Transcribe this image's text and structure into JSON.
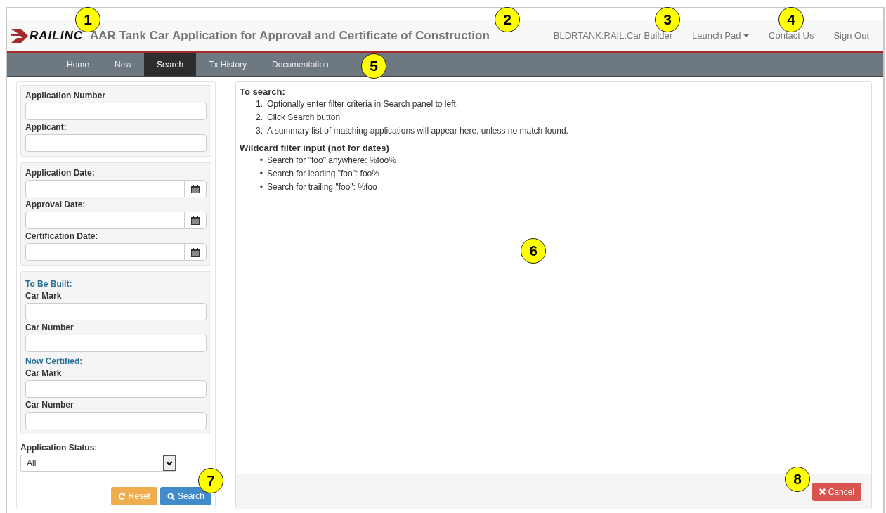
{
  "header": {
    "logo_text": "RAILINC",
    "title": "AAR Tank Car Application for Approval and Certificate of Construction",
    "menu": [
      {
        "label": "BLDRTANK:RAIL:Car Builder",
        "kind": "text"
      },
      {
        "label": "Launch Pad",
        "kind": "dropdown"
      },
      {
        "label": "Contact Us",
        "kind": "link"
      },
      {
        "label": "Sign Out",
        "kind": "link"
      }
    ]
  },
  "tabs": [
    {
      "label": "Home",
      "selected": false
    },
    {
      "label": "New",
      "selected": false
    },
    {
      "label": "Search",
      "selected": true
    },
    {
      "label": "Tx History",
      "selected": false
    },
    {
      "label": "Documentation",
      "selected": false
    }
  ],
  "filter_groups": [
    {
      "items": [
        {
          "kind": "text",
          "label": "Application Number"
        },
        {
          "kind": "text",
          "label": "Applicant:"
        }
      ]
    },
    {
      "items": [
        {
          "kind": "date",
          "label": "Application Date:"
        },
        {
          "kind": "date",
          "label": "Approval Date:"
        },
        {
          "kind": "date",
          "label": "Certification Date:"
        }
      ]
    },
    {
      "items": [
        {
          "kind": "heading",
          "label": "To Be Built:"
        },
        {
          "kind": "text",
          "label": "Car Mark"
        },
        {
          "kind": "text",
          "label": "Car Number"
        },
        {
          "kind": "heading",
          "label": "Now Certified:"
        },
        {
          "kind": "text",
          "label": "Car Mark"
        },
        {
          "kind": "text",
          "label": "Car Number"
        }
      ]
    }
  ],
  "status": {
    "label": "Application Status:",
    "value": "All"
  },
  "buttons": [
    {
      "label": "Reset",
      "kind": "reset"
    },
    {
      "label": "Search",
      "kind": "search"
    }
  ],
  "help": {
    "heading": "To search:",
    "steps": [
      {
        "marker": "1.",
        "text": "Optionally enter filter criteria in Search panel to left."
      },
      {
        "marker": "2.",
        "text": "Click Search button"
      },
      {
        "marker": "3.",
        "text": "A summary list of matching applications will appear here, unless no match found."
      }
    ],
    "wildcard_heading": "Wildcard filter input (not for dates)",
    "wildcards": [
      {
        "marker": "•",
        "text": "Search for \"foo\" anywhere: %foo%"
      },
      {
        "marker": "•",
        "text": "Search for leading \"foo\": foo%"
      },
      {
        "marker": "•",
        "text": "Search for trailing \"foo\": %foo"
      }
    ]
  },
  "cancel_button": "Cancel",
  "callouts": [
    "1",
    "2",
    "3",
    "4",
    "5",
    "6",
    "7",
    "8"
  ]
}
